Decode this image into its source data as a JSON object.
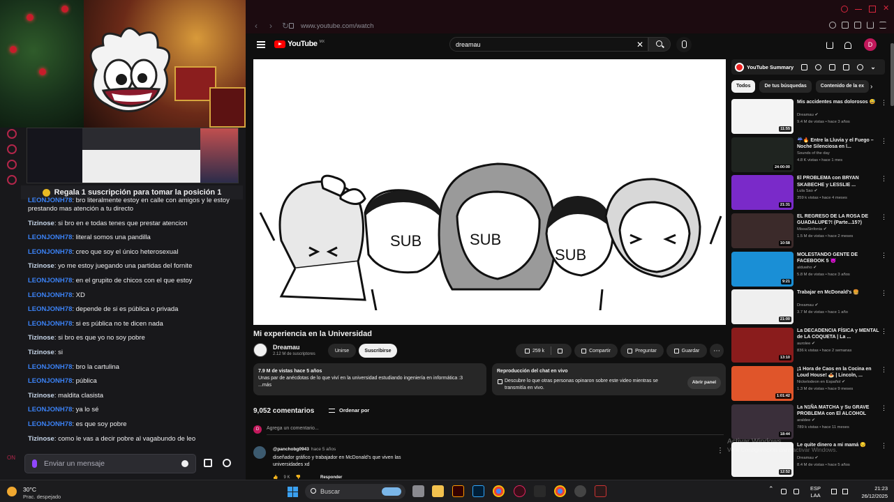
{
  "stream": {
    "gift_banner": "Regala 1 suscripción para tomar la posición 1",
    "chat_messages": [
      {
        "user": "LEONJONH78",
        "text": ": bro literalmente estoy en calle con amigos y le estoy prestando mas atención a tu directo",
        "color": "blue"
      },
      {
        "user": "Tizinose",
        "text": ": si bro en e todas tenes que prestar atencion",
        "color": "pale"
      },
      {
        "user": "LEONJONH78",
        "text": ": literal somos una pandilla",
        "color": "blue"
      },
      {
        "user": "LEONJONH78",
        "text": ": creo que soy el único heterosexual",
        "color": "blue"
      },
      {
        "user": "Tizinose",
        "text": ": yo me estoy juegando una partidas del fornite",
        "color": "pale"
      },
      {
        "user": "LEONJONH78",
        "text": ": en el grupito de chicos con el que estoy",
        "color": "blue"
      },
      {
        "user": "LEONJONH78",
        "text": ": XD",
        "color": "blue"
      },
      {
        "user": "LEONJONH78",
        "text": ": depende de si es pública o privada",
        "color": "blue"
      },
      {
        "user": "LEONJONH78",
        "text": ": si es pública no te dicen nada",
        "color": "blue"
      },
      {
        "user": "Tizinose",
        "text": ": si bro es que yo no soy pobre",
        "color": "pale"
      },
      {
        "user": "Tizinose",
        "text": ": si",
        "color": "pale"
      },
      {
        "user": "LEONJONH78",
        "text": ": bro la cartulina",
        "color": "blue"
      },
      {
        "user": "LEONJONH78",
        "text": ": pública",
        "color": "blue"
      },
      {
        "user": "Tizinose",
        "text": ": maldita clasista",
        "color": "pale"
      },
      {
        "user": "LEONJONH78",
        "text": ": ya lo sé",
        "color": "blue"
      },
      {
        "user": "LEONJONH78",
        "text": ": es que soy pobre",
        "color": "blue"
      },
      {
        "user": "Tizinose",
        "text": ": como le vas a decir pobre al vagabundo de leo",
        "color": "pale"
      }
    ],
    "chat_placeholder": "Enviar un mensaje",
    "side_label": "ON"
  },
  "browser": {
    "url": "www.youtube.com/watch",
    "logo_word": "YouTube",
    "logo_cc": "MX",
    "search_query": "dreamau",
    "avatar_letter": "D"
  },
  "video": {
    "title": "Mi experiencia en la Universidad",
    "channel": "Dreamau",
    "subscribers": "2.12 M de suscriptores",
    "join_label": "Unirse",
    "subscribe_label": "Suscribirse",
    "likes": "259 k",
    "share_label": "Compartir",
    "ask_label": "Preguntar",
    "save_label": "Guardar",
    "desc_meta": "7.9 M de vistas  hace 5 años",
    "desc_text": "Unas par de anécdotas de lo que viví en la universidad estudiando ingeniería en informática :3",
    "desc_more": "...más",
    "chat_replay_title": "Reproducción del chat en vivo",
    "chat_replay_body": "Descubre lo que otras personas opinaron sobre este video mientras se transmitía en vivo.",
    "open_panel": "Abrir panel",
    "sub_word": "SUB"
  },
  "comments": {
    "count": "9,052 comentarios",
    "sort_label": "Ordenar por",
    "add_placeholder": "Agrega un comentario...",
    "avatar_letter": "D",
    "first": {
      "author": "@panchobg0943",
      "ago": "hace 5 años",
      "text": "diseñador gráfico y trabajador en McDonald's que viven las universidades xd",
      "likes": "9 K",
      "reply_label": "Responder"
    }
  },
  "sidebar": {
    "summary_title": "YouTube Summary",
    "chips": [
      {
        "label": "Todos",
        "active": true
      },
      {
        "label": "De tus búsquedas",
        "active": false
      },
      {
        "label": "Contenido de la ex",
        "active": false
      }
    ],
    "recs": [
      {
        "title": "Mis accidentes mas dolorosos 😅",
        "channel": "Dreamau ✔",
        "stats": "9.4 M de vistas • hace 3 años",
        "duration": "11:55",
        "thumb": "#f4f4f4"
      },
      {
        "title": "☔🔥 Entre la Lluvia y el Fuego – Noche Silenciosa en l...",
        "channel": "Sounds of the day",
        "stats": "4.8 K vistas • hace 1 mes",
        "duration": "24:00:00",
        "thumb": "#1f2420"
      },
      {
        "title": "El PROBLEMA con BRYAN SKABECHE y LESSLIE ...",
        "channel": "Lula Sao ✔",
        "stats": "359 k vistas • hace 4 meses",
        "duration": "21:31",
        "thumb": "#7a2ac9"
      },
      {
        "title": "EL REGRESO DE LA ROSA DE GUADALUPE?! (Parte...15?)",
        "channel": "MissaSinfonia ✔",
        "stats": "1.5 M de vistas • hace 2 meses",
        "duration": "10:58",
        "thumb": "#3b2a2a"
      },
      {
        "title": "MOLESTANDO GENTE DE FACEBOOK 5 😈",
        "channel": "alduwho ✔",
        "stats": "5.8 M de vistas • hace 3 años",
        "duration": "9:21",
        "thumb": "#1a8fd6"
      },
      {
        "title": "Trabajar en McDonald's 🍔",
        "channel": "Dreamau ✔",
        "stats": "3.7 M de vistas • hace 1 año",
        "duration": "21:00",
        "thumb": "#efefef"
      },
      {
        "title": "La DECADENCIA FÍSICA y MENTAL de LA COQUETA | La ...",
        "channel": "aurolee ✔",
        "stats": "836 k vistas • hace 2 semanas",
        "duration": "13:10",
        "thumb": "#8a1c1c"
      },
      {
        "title": "¡1 Hora de Caos en la Cocina en Loud House! 🍝 | Lincoln, ...",
        "channel": "Nickelodeon en Español ✔",
        "stats": "1.3 M de vistas • hace 9 meses",
        "duration": "1:01:42",
        "thumb": "#e0552a"
      },
      {
        "title": "La N1ÑA MATCHA y Su GRAVE PROBLEMA con El ALCOHOL",
        "channel": "araldee ✔",
        "stats": "789 k vistas • hace 11 meses",
        "duration": "18:44",
        "thumb": "#3a2f3a"
      },
      {
        "title": "Le quite dinero a mi mamá 😏",
        "channel": "Dreamau ✔",
        "stats": "8.4 M de vistas • hace 5 años",
        "duration": "12:52",
        "thumb": "#f2f2f2"
      }
    ],
    "watermark_line1": "Activar Windows",
    "watermark_line2": "Ve a Configuración para activar Windows."
  },
  "taskbar": {
    "temperature": "30°C",
    "condition": "Prac. despejado",
    "search_label": "Buscar",
    "lang_1": "ESP",
    "lang_2": "LAA",
    "time": "21:23",
    "date": "26/12/2025"
  }
}
